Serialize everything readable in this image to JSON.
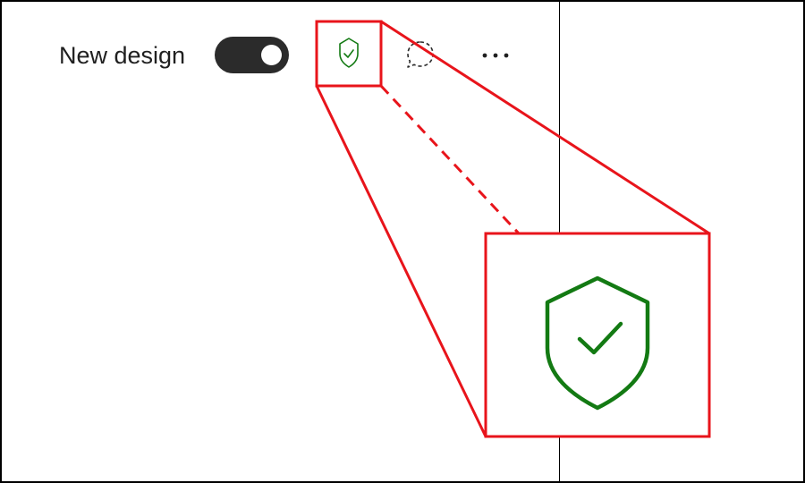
{
  "toolbar": {
    "label": "New design",
    "toggle_on": true,
    "icons": [
      "shield-check-icon",
      "chat-bubble-icon",
      "more-icon"
    ]
  },
  "colors": {
    "highlight": "#e8141b",
    "shield": "#137a13",
    "toggle_bg": "#2b2b2b",
    "text": "#202020"
  }
}
